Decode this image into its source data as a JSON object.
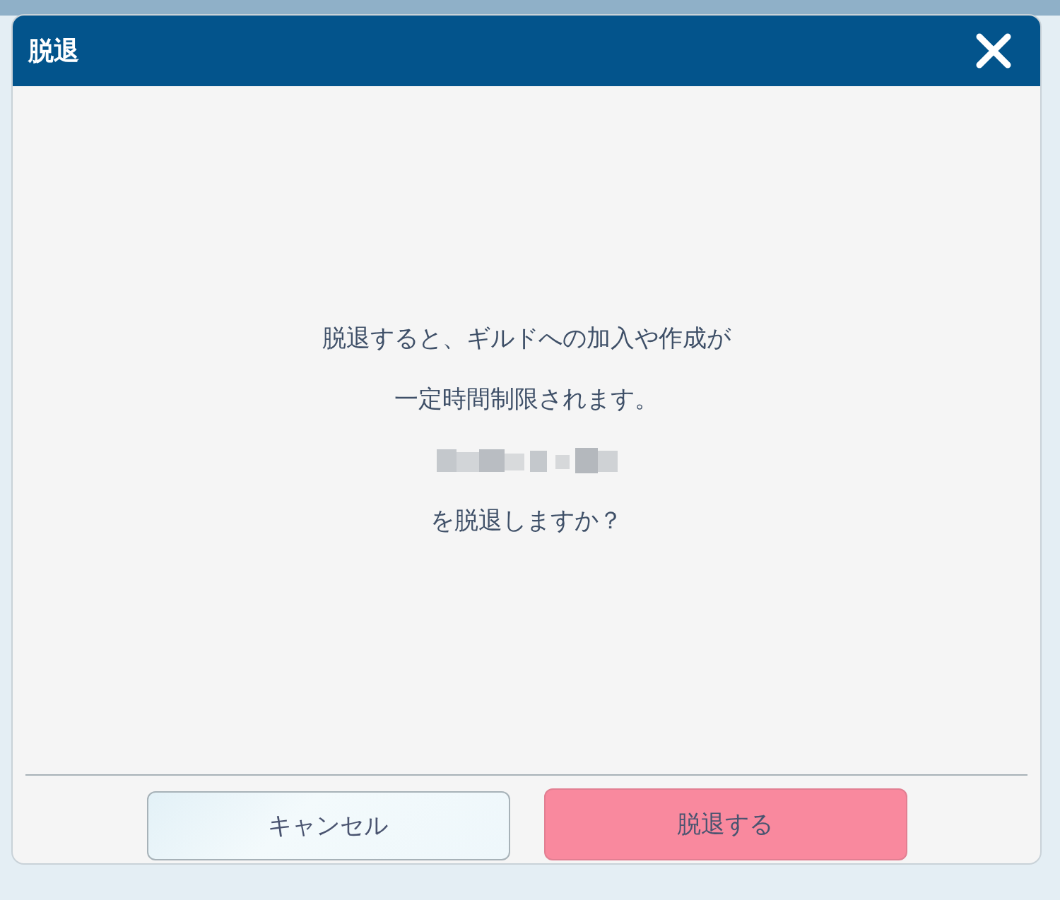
{
  "dialog": {
    "title": "脱退",
    "message": [
      {
        "kind": "text",
        "text": "脱退すると、ギルドへの加入や作成が"
      },
      {
        "kind": "text",
        "text": "一定時間制限されます。"
      },
      {
        "kind": "redacted"
      },
      {
        "kind": "text",
        "text": "を脱退しますか？"
      }
    ],
    "buttons": [
      {
        "label": "キャンセル",
        "kind": "secondary"
      },
      {
        "label": "脱退する",
        "kind": "primary"
      }
    ]
  }
}
